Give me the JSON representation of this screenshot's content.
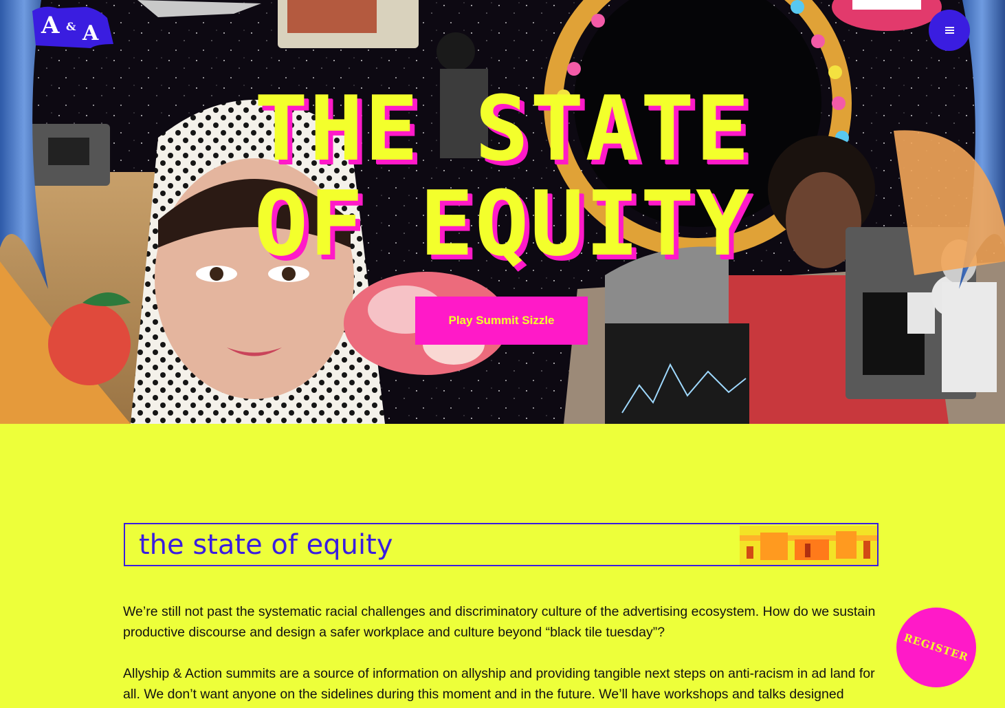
{
  "brand": {
    "logo_text": "A&A"
  },
  "hero": {
    "title_line1": "THE STATE",
    "title_line2": "OF EQUITY",
    "cta_label": "Play Summit Sizzle"
  },
  "section": {
    "heading": "the state of equity",
    "paragraph1": "We’re still not past the systematic racial challenges and discriminatory culture of the advertising ecosystem. How do we sustain productive discourse and design a safer workplace and culture beyond “black tile tuesday”?",
    "paragraph2": "Allyship & Action summits are a source of information on allyship and providing tangible next steps on anti-racism in ad land for all. We don’t want anyone on the sidelines during this moment and in the future. We’ll have workshops and talks designed"
  },
  "register": {
    "label": "REGISTER"
  },
  "icons": {
    "menu": "hamburger-menu-icon",
    "logo": "aa-logo-icon"
  },
  "colors": {
    "yellow": "#edff3a",
    "title_yellow": "#f3ff2c",
    "magenta": "#ff1ac8",
    "blue": "#3a1de0"
  }
}
